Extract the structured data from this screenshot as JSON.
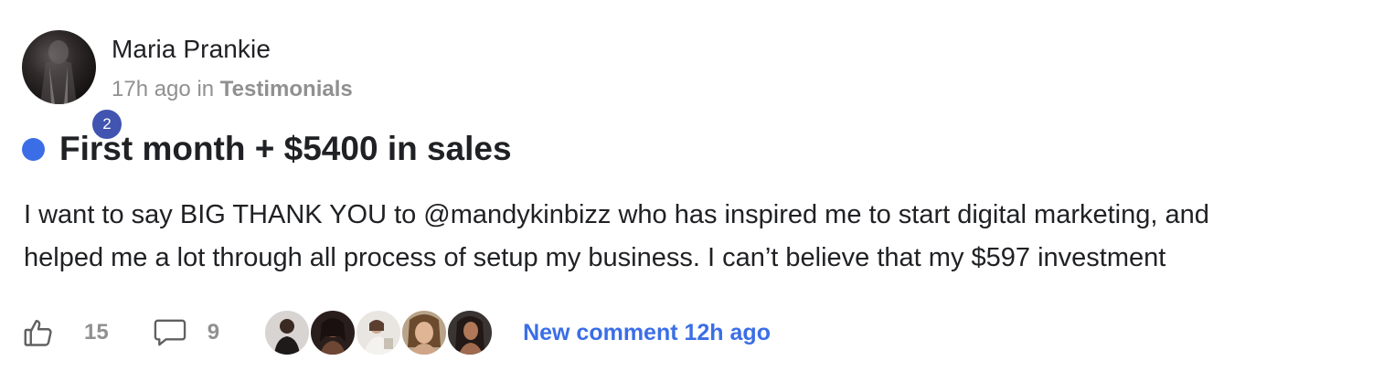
{
  "post": {
    "author": "Maria Prankie",
    "level": "2",
    "time": "17h ago",
    "in_word": "in",
    "category": "Testimonials",
    "title": "First month + $5400 in sales",
    "body_line1": "I want to say BIG THANK YOU to @mandykinbizz who has inspired me to start digital marketing, and",
    "body_line2": "helped me a lot through all process of setup my business. I can’t believe that my $597 investment"
  },
  "footer": {
    "like_icon": "thumbs-up-icon",
    "like_count": "15",
    "comment_icon": "comment-bubble-icon",
    "comment_count": "9",
    "new_comment": "New comment 12h ago"
  },
  "colors": {
    "accent": "#3b6ee6",
    "level_badge": "#4154b0",
    "muted_text": "#909090",
    "primary_text": "#202124"
  }
}
